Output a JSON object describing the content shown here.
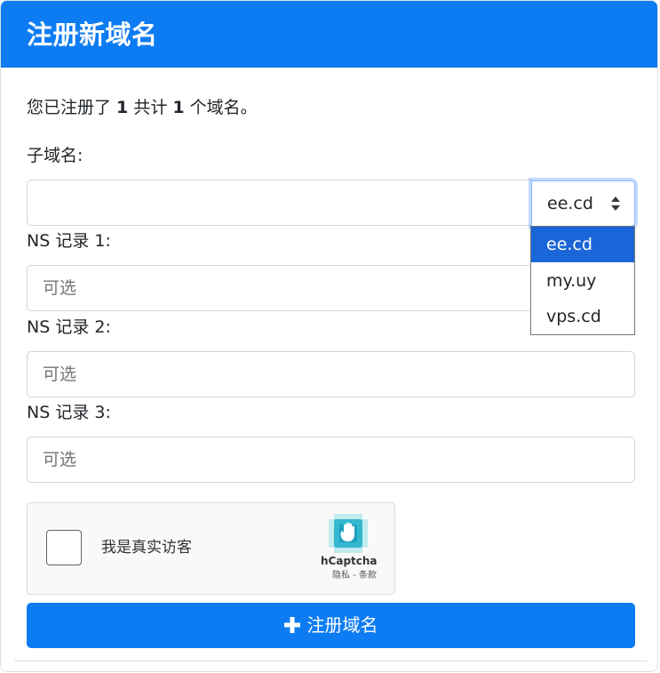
{
  "header": {
    "title": "注册新域名"
  },
  "summary": {
    "prefix": "您已注册了 ",
    "registered_count": "1",
    "middle": " 共计 ",
    "total_count": "1",
    "suffix": " 个域名。"
  },
  "form": {
    "subdomain_label": "子域名:",
    "subdomain_value": "",
    "domain_select": {
      "selected": "ee.cd",
      "options": [
        "ee.cd",
        "my.uy",
        "vps.cd"
      ]
    },
    "ns1_label": "NS 记录 1:",
    "ns1_placeholder": "可选",
    "ns2_label": "NS 记录 2:",
    "ns2_placeholder": "可选",
    "ns3_label": "NS 记录 3:",
    "ns3_placeholder": "可选"
  },
  "captcha": {
    "label": "我是真实访客",
    "brand": "hCaptcha",
    "links": "隐私 - 条款"
  },
  "submit": {
    "label": "注册域名"
  },
  "colors": {
    "primary": "#0d7cf2",
    "dropdown_selected": "#1a66d8"
  }
}
